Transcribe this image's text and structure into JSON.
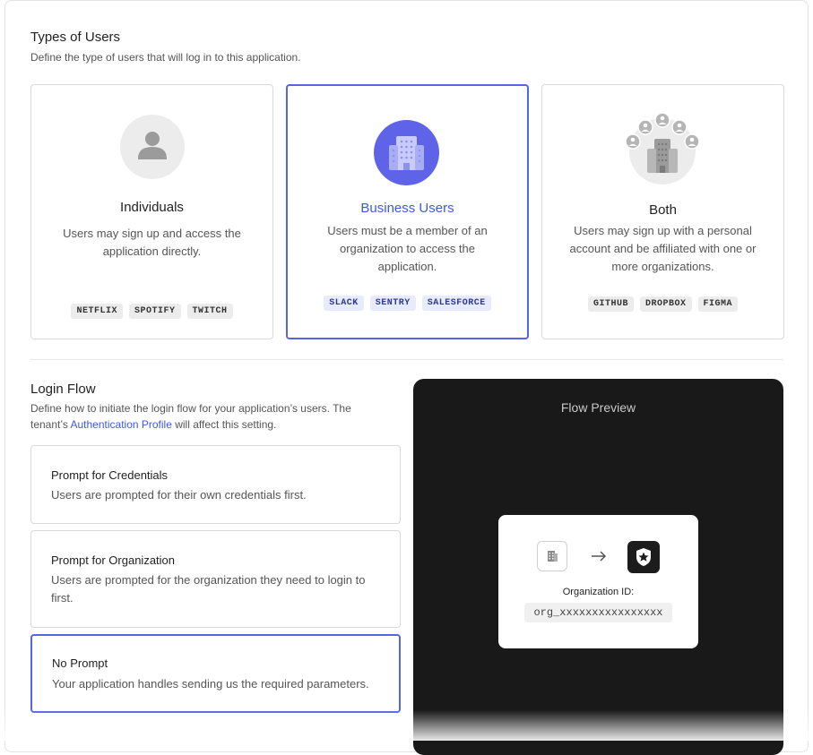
{
  "types_section": {
    "title": "Types of Users",
    "description": "Define the type of users that will log in to this application."
  },
  "user_types": [
    {
      "name": "Individuals",
      "description": "Users may sign up and access the application directly.",
      "examples": [
        "NETFLIX",
        "SPOTIFY",
        "TWITCH"
      ],
      "icon": "person-icon",
      "selected": false
    },
    {
      "name": "Business Users",
      "description": "Users must be a member of an organization to access the application.",
      "examples": [
        "SLACK",
        "SENTRY",
        "SALESFORCE"
      ],
      "icon": "building-icon",
      "selected": true
    },
    {
      "name": "Both",
      "description": "Users may sign up with a personal account and be affiliated with one or more organizations.",
      "examples": [
        "GITHUB",
        "DROPBOX",
        "FIGMA"
      ],
      "icon": "building-with-people-icon",
      "selected": false
    }
  ],
  "login_section": {
    "title": "Login Flow",
    "description_before": "Define how to initiate the login flow for your application’s users. The tenant’s ",
    "link": "Authentication Profile",
    "description_after": " will affect this setting."
  },
  "login_options": [
    {
      "title": "Prompt for Credentials",
      "description": "Users are prompted for their own credentials first.",
      "selected": false
    },
    {
      "title": "Prompt for Organization",
      "description": "Users are prompted for the organization they need to login to first.",
      "selected": false
    },
    {
      "title": "No Prompt",
      "description": "Your application handles sending us the required parameters.",
      "selected": true
    }
  ],
  "preview": {
    "title": "Flow Preview",
    "org_label": "Organization ID:",
    "org_value": "org_xxxxxxxxxxxxxxxx",
    "icons": [
      "building-icon",
      "arrow-right-icon",
      "shield-star-icon"
    ]
  },
  "colors": {
    "accent": "#5666e3",
    "link": "#3f59e4",
    "preview_bg": "#191919"
  }
}
